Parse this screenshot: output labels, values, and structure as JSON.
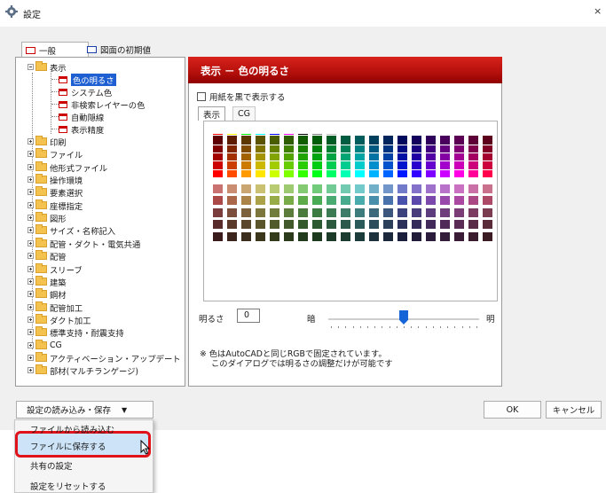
{
  "window": {
    "title": "設定",
    "close_glyph": "×"
  },
  "tabs": [
    {
      "label": "一般",
      "icon": "red-frame-icon",
      "active": true
    },
    {
      "label": "図面の初期値",
      "icon": "blue-frame-icon",
      "active": false
    }
  ],
  "tree": {
    "display_node": "表示",
    "children": [
      "色の明るさ",
      "システム色",
      "非検索レイヤーの色",
      "自動隠線",
      "表示精度"
    ],
    "selected": "色の明るさ",
    "folders": [
      "印刷",
      "ファイル",
      "他形式ファイル",
      "操作環境",
      "要素選択",
      "座標指定",
      "図形",
      "サイズ・名称記入",
      "配管・ダクト・電気共通",
      "配管",
      "スリーブ",
      "建築",
      "鋼材",
      "配管加工",
      "ダクト加工",
      "標準支持・耐震支持",
      "CG",
      "アクティベーション・アップデート",
      "部材(マルチランゲージ)"
    ]
  },
  "panel": {
    "header": "表示 － 色の明るさ",
    "paper_black_label": "用紙を黒で表示する",
    "paper_black_checked": false,
    "subtabs": [
      "表示",
      "CG"
    ],
    "palette": {
      "row1": [
        "#ff0000",
        "#ffff00",
        "#00ff00",
        "#00ffff",
        "#0000ff",
        "#ff00ff",
        "#000000",
        "#808080",
        "#c0c0c0"
      ],
      "row2": [
        "#000000",
        "#333333",
        "#555555",
        "#808080",
        "#aaaaaa",
        "#c0c0c0"
      ]
    },
    "brightness_label": "明るさ",
    "brightness_value": "0",
    "dark_label": "暗",
    "light_label": "明",
    "slider_fraction": 0.5,
    "note_line1": "※ 色はAutoCADと同じRGBで固定されています。",
    "note_line2": "このダイアログでは明るさの調整だけが可能です"
  },
  "buttons": {
    "load_save": "設定の読み込み・保存",
    "load_save_arrow": "▼",
    "ok": "OK",
    "cancel": "キャンセル"
  },
  "menu": {
    "items": [
      "ファイルから読み込む",
      "ファイルに保存する",
      "共有の設定",
      "設定をリセットする"
    ],
    "highlighted": "ファイルに保存する"
  },
  "colors": {
    "accent": "#c4120e",
    "selection": "#1e5fd1",
    "highlight_border": "#e0121a"
  }
}
